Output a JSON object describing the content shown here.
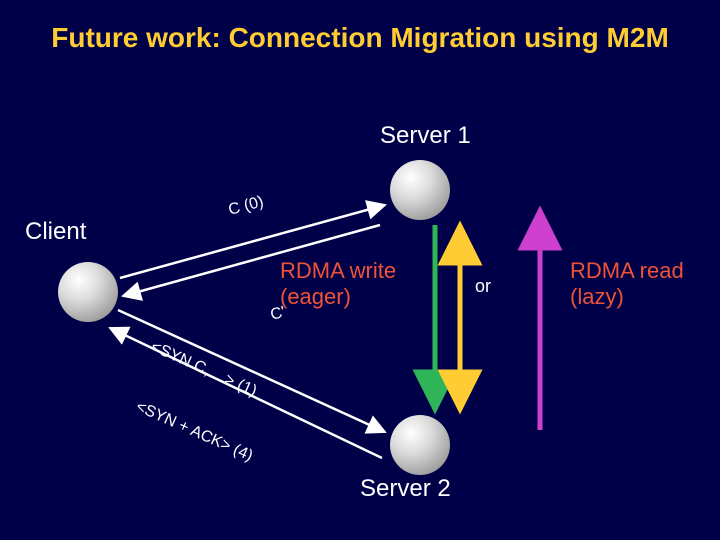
{
  "title": "Future work: Connection Migration using M2M",
  "labels": {
    "server1": "Server 1",
    "server2": "Server 2",
    "client": "Client",
    "or": "or"
  },
  "edges": {
    "c0": "C (0)",
    "cprime": "C'",
    "syn": "<SYN C, ...>  (1)",
    "synack": "<SYN + ACK>  (4)"
  },
  "rdma": {
    "write_l1": "RDMA write",
    "write_l2": "(eager)",
    "read_l1": "RDMA read",
    "read_l2": "(lazy)"
  },
  "colors": {
    "title": "#ffcc33",
    "text": "#ffffff",
    "rdma": "#ef5337",
    "arrow_green": "#2fb457",
    "arrow_magenta": "#cc3fcf",
    "arrow_yellow": "#ffcc33",
    "bg": "#000048"
  }
}
